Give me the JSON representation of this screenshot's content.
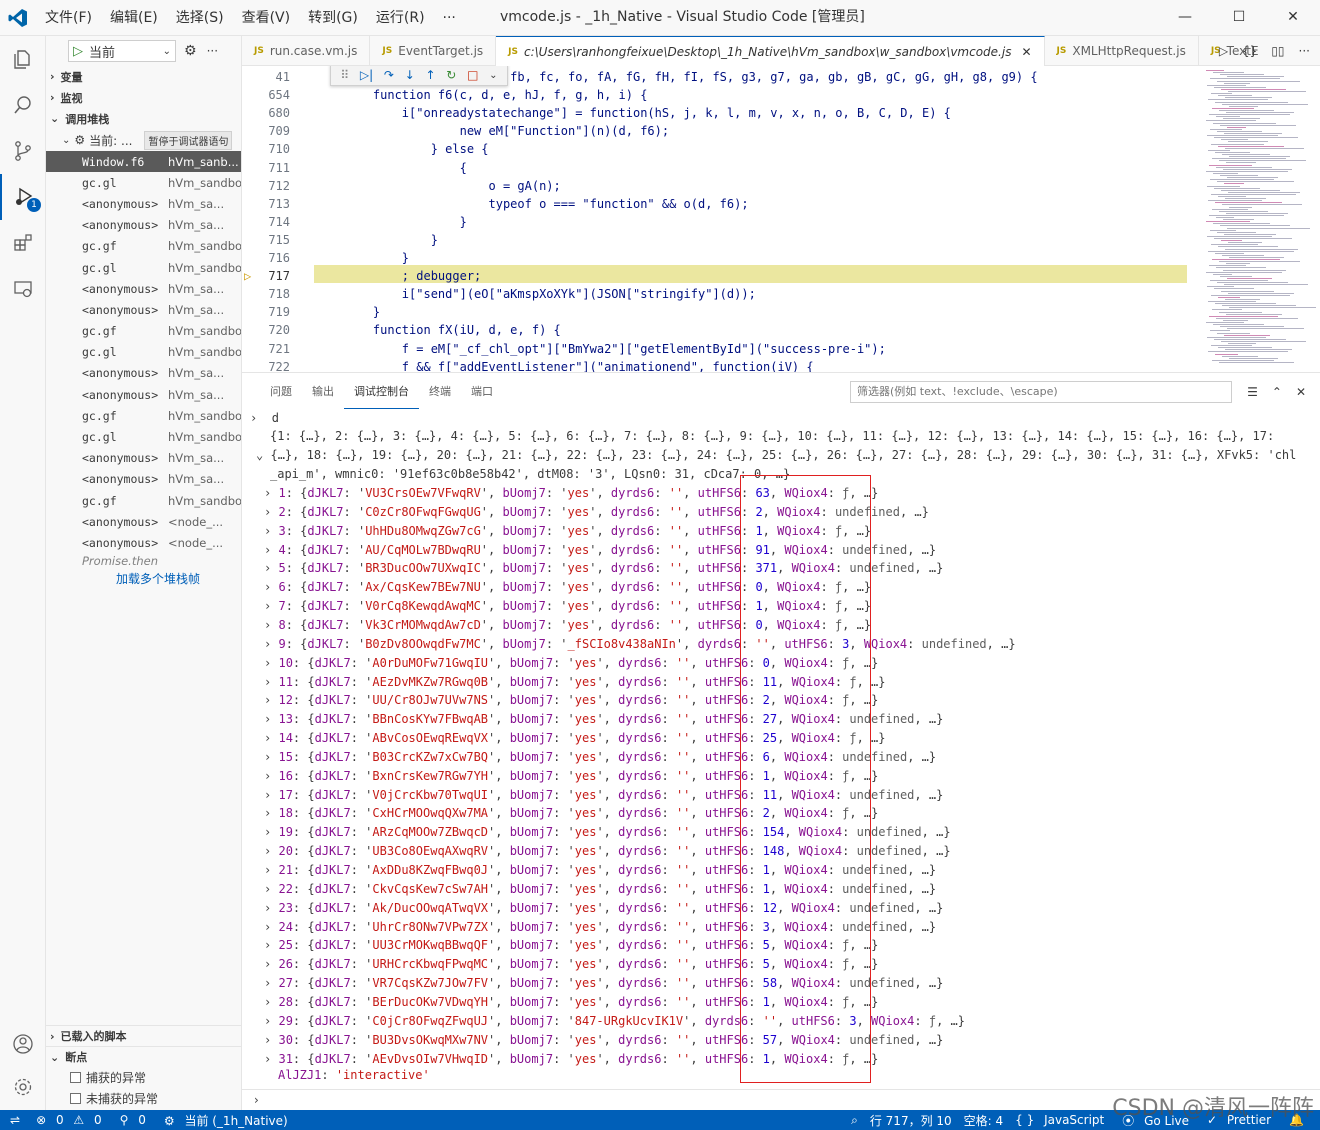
{
  "titlebar": {
    "menus": [
      "文件(F)",
      "编辑(E)",
      "选择(S)",
      "查看(V)",
      "转到(G)",
      "运行(R)",
      "···"
    ],
    "title": "vmcode.js - _1h_Native - Visual Studio Code [管理员]"
  },
  "activitybar": {
    "debug_badge": "1"
  },
  "sidebar": {
    "run_config": "当前",
    "sections": {
      "variables": "变量",
      "watch": "监视",
      "callstack": "调用堆栈",
      "loaded_scripts": "已载入的脚本",
      "breakpoints": "断点"
    },
    "thread_label": "当前: ...",
    "paused_badge": "暂停于调试器语句",
    "frames": [
      {
        "fn": "Window.f6",
        "src": "hVm_sanb..."
      },
      {
        "fn": "gc.gl",
        "src": "hVm_sandbox/w..."
      },
      {
        "fn": "<anonymous>",
        "src": "hVm_sa..."
      },
      {
        "fn": "<anonymous>",
        "src": "hVm_sa..."
      },
      {
        "fn": "gc.gf",
        "src": "hVm_sandbox/w..."
      },
      {
        "fn": "gc.gl",
        "src": "hVm_sandbox/w..."
      },
      {
        "fn": "<anonymous>",
        "src": "hVm_sa..."
      },
      {
        "fn": "<anonymous>",
        "src": "hVm_sa..."
      },
      {
        "fn": "gc.gf",
        "src": "hVm_sandbox/w..."
      },
      {
        "fn": "gc.gl",
        "src": "hVm_sandbox/w..."
      },
      {
        "fn": "<anonymous>",
        "src": "hVm_sa..."
      },
      {
        "fn": "<anonymous>",
        "src": "hVm_sa..."
      },
      {
        "fn": "gc.gf",
        "src": "hVm_sandbox/w..."
      },
      {
        "fn": "gc.gl",
        "src": "hVm_sandbox/w..."
      },
      {
        "fn": "<anonymous>",
        "src": "hVm_sa..."
      },
      {
        "fn": "<anonymous>",
        "src": "hVm_sa..."
      },
      {
        "fn": "gc.gf",
        "src": "hVm_sandbox/w..."
      },
      {
        "fn": "<anonymous>",
        "src": "<node_..."
      },
      {
        "fn": "<anonymous>",
        "src": "<node_..."
      }
    ],
    "promise_then": "Promise.then",
    "load_more": "加载多个堆栈帧",
    "breakpoint_options": [
      "捕获的异常",
      "未捕获的异常"
    ]
  },
  "tabs": [
    {
      "name": "run.case.vm.js"
    },
    {
      "name": "EventTarget.js"
    },
    {
      "name": "c:\\Users\\ranhongfeixue\\Desktop\\_1h_Native\\hVm_sandbox\\w_sandbox\\vmcode.js"
    },
    {
      "name": "XMLHttpRequest.js"
    },
    {
      "name": "TextE"
    }
  ],
  "editor": {
    "lines": [
      {
        "n": "41",
        "t": "~  eP, eW, f5, f8, fa, fb, fc, fo, fA, fG, fH, fI, fS, g3, g7, ga, gb, gB, gC, gG, gH, g8, g9) {"
      },
      {
        "n": "654",
        "t": "    function f6(c, d, e, hJ, f, g, h, i) {"
      },
      {
        "n": "680",
        "t": "        i[\"onreadystatechange\"] = function(hS, j, k, l, m, v, x, n, o, B, C, D, E) {"
      },
      {
        "n": "709",
        "t": "                new eM[\"Function\"](n)(d, f6);"
      },
      {
        "n": "710",
        "t": "            } else {"
      },
      {
        "n": "711",
        "t": "                {"
      },
      {
        "n": "712",
        "t": "                    o = gA(n);"
      },
      {
        "n": "713",
        "t": "                    typeof o === \"function\" && o(d, f6);"
      },
      {
        "n": "714",
        "t": "                }"
      },
      {
        "n": "715",
        "t": "            }"
      },
      {
        "n": "716",
        "t": "        }"
      },
      {
        "n": "717",
        "t": "        ; debugger;"
      },
      {
        "n": "718",
        "t": "        i[\"send\"](eO[\"aKmspXoXYk\"](JSON[\"stringify\"](d));"
      },
      {
        "n": "719",
        "t": "    }"
      },
      {
        "n": "720",
        "t": "    function fX(iU, d, e, f) {"
      },
      {
        "n": "721",
        "t": "        f = eM[\"_cf_chl_opt\"][\"BmYwa2\"][\"getElementById\"](\"success-pre-i\");"
      },
      {
        "n": "722",
        "t": "        f && f[\"addEventListener\"](\"animationend\", function(iV) {"
      }
    ]
  },
  "panel": {
    "tabs": [
      "问题",
      "输出",
      "调试控制台",
      "终端",
      "端口"
    ],
    "filter_placeholder": "筛选器(例如 text、!exclude、\\escape)",
    "console": {
      "input": "d",
      "summary1": "{1: {…}, 2: {…}, 3: {…}, 4: {…}, 5: {…}, 6: {…}, 7: {…}, 8: {…}, 9: {…}, 10: {…}, 11: {…}, 12: {…}, 13: {…}, 14: {…}, 15: {…}, 16: {…}, 17:",
      "summary2": "{…}, 18: {…}, 19: {…}, 20: {…}, 21: {…}, 22: {…}, 23: {…}, 24: {…}, 25: {…}, 26: {…}, 27: {…}, 28: {…}, 29: {…}, 30: {…}, 31: {…}, XFvk5: 'chl",
      "summary3": "_api_m', wmnic0: '91ef63c0b8e58b42', dtM08: '3', LQsn0: 31, cDca7: 0, …}",
      "rows": [
        {
          "i": "1",
          "k": "VU3CrsOEw7VFwqRV",
          "b": "yes",
          "u": "63",
          "w": "ƒ"
        },
        {
          "i": "2",
          "k": "C0zCr8OFwqFGwqUG",
          "b": "yes",
          "u": "2",
          "w": "undefined"
        },
        {
          "i": "3",
          "k": "UhHDu8OMwqZGw7cG",
          "b": "yes",
          "u": "1",
          "w": "ƒ"
        },
        {
          "i": "4",
          "k": "AU/CqMOLw7BDwqRU",
          "b": "yes",
          "u": "91",
          "w": "undefined"
        },
        {
          "i": "5",
          "k": "BR3DucOOw7UXwqIC",
          "b": "yes",
          "u": "371",
          "w": "undefined"
        },
        {
          "i": "6",
          "k": "Ax/CqsKew7BEw7NU",
          "b": "yes",
          "u": "0",
          "w": "ƒ"
        },
        {
          "i": "7",
          "k": "V0rCq8KewqdAwqMC",
          "b": "yes",
          "u": "1",
          "w": "ƒ"
        },
        {
          "i": "8",
          "k": "Vk3CrMOMwqdAw7cD",
          "b": "yes",
          "u": "0",
          "w": "ƒ"
        },
        {
          "i": "9",
          "k": "B0zDv8OOwqdFw7MC",
          "b": "_fSCIo8v438aNIn",
          "u": "3",
          "w": "undefined"
        },
        {
          "i": "10",
          "k": "A0rDuMOFw71GwqIU",
          "b": "yes",
          "u": "0",
          "w": "ƒ"
        },
        {
          "i": "11",
          "k": "AEzDvMKZw7RGwq0B",
          "b": "yes",
          "u": "11",
          "w": "ƒ"
        },
        {
          "i": "12",
          "k": "UU/Cr8OJw7UVw7NS",
          "b": "yes",
          "u": "2",
          "w": "ƒ"
        },
        {
          "i": "13",
          "k": "BBnCosKYw7FBwqAB",
          "b": "yes",
          "u": "27",
          "w": "undefined"
        },
        {
          "i": "14",
          "k": "ABvCosOEwqREwqVX",
          "b": "yes",
          "u": "25",
          "w": "ƒ"
        },
        {
          "i": "15",
          "k": "B03CrcKZw7xCw7BQ",
          "b": "yes",
          "u": "6",
          "w": "undefined"
        },
        {
          "i": "16",
          "k": "BxnCrsKew7RGw7YH",
          "b": "yes",
          "u": "1",
          "w": "ƒ"
        },
        {
          "i": "17",
          "k": "V0jCrcKbw70TwqUI",
          "b": "yes",
          "u": "11",
          "w": "undefined"
        },
        {
          "i": "18",
          "k": "CxHCrMOOwqQXw7MA",
          "b": "yes",
          "u": "2",
          "w": "ƒ"
        },
        {
          "i": "19",
          "k": "ARzCqMOOw7ZBwqcD",
          "b": "yes",
          "u": "154",
          "w": "undefined"
        },
        {
          "i": "20",
          "k": "UB3Co8OEwqAXwqRV",
          "b": "yes",
          "u": "148",
          "w": "undefined"
        },
        {
          "i": "21",
          "k": "AxDDu8KZwqFBwq0J",
          "b": "yes",
          "u": "1",
          "w": "undefined"
        },
        {
          "i": "22",
          "k": "CkvCqsKew7cSw7AH",
          "b": "yes",
          "u": "1",
          "w": "undefined"
        },
        {
          "i": "23",
          "k": "Ak/DucOOwqATwqVX",
          "b": "yes",
          "u": "12",
          "w": "undefined"
        },
        {
          "i": "24",
          "k": "UhrCr8ONw7VPw7ZX",
          "b": "yes",
          "u": "3",
          "w": "undefined"
        },
        {
          "i": "25",
          "k": "UU3CrMOKwqBBwqQF",
          "b": "yes",
          "u": "5",
          "w": "ƒ"
        },
        {
          "i": "26",
          "k": "URHCrcKbwqFPwqMC",
          "b": "yes",
          "u": "5",
          "w": "ƒ"
        },
        {
          "i": "27",
          "k": "VR7CqsKZw7JOw7FV",
          "b": "yes",
          "u": "58",
          "w": "undefined"
        },
        {
          "i": "28",
          "k": "BErDucOKw7VDwqYH",
          "b": "yes",
          "u": "1",
          "w": "ƒ"
        },
        {
          "i": "29",
          "k": "C0jCr8OFwqZFwqUJ",
          "b": "847-URgkUcvIK1V",
          "u": "3",
          "w": "ƒ"
        },
        {
          "i": "30",
          "k": "BU3DvsOKwqMXw7NV",
          "b": "yes",
          "u": "57",
          "w": "undefined"
        },
        {
          "i": "31",
          "k": "AEvDvsOIw7VHwqID",
          "b": "yes",
          "u": "1",
          "w": "ƒ"
        }
      ],
      "tail_key": "AlJZJ1",
      "tail_val": "'interactive'"
    }
  },
  "statusbar": {
    "errors": "0",
    "warnings": "0",
    "ports": "0",
    "session": "当前 (_1h_Native)",
    "position": "行 717，列 10",
    "spaces": "空格: 4",
    "language": "JavaScript",
    "golive": "Go Live",
    "prettier": "Prettier"
  },
  "watermark": "CSDN @清风一阵阵"
}
